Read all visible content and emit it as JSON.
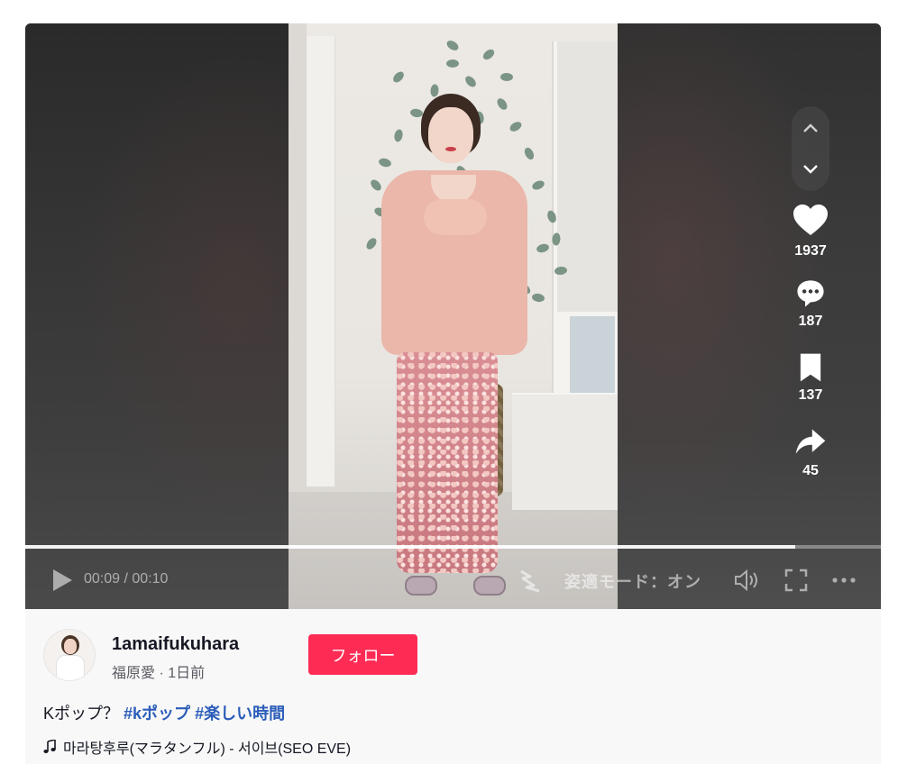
{
  "player": {
    "time_display": "00:09 / 00:10",
    "progress_fraction": 0.9,
    "mode_text": "姿適モード：オン"
  },
  "actions": {
    "likes": "1937",
    "comments": "187",
    "saves": "137",
    "shares": "45"
  },
  "author": {
    "username": "1amaifukuhara",
    "display_name_and_time": "福原愛 · 1日前",
    "follow_label": "フォロー"
  },
  "post": {
    "caption_text": "Kポップ？",
    "hashtags": [
      "#kポップ",
      "#楽しい時間"
    ],
    "music": "마라탕후루(マラタンフル) - 서이브(SEO EVE)"
  },
  "colors": {
    "follow_button": "#fe2c55",
    "hashtag": "#2b5db9",
    "panel_bg": "#f8f8f8"
  },
  "icons": [
    "chevron-up-icon",
    "chevron-down-icon",
    "heart-icon",
    "comment-icon",
    "bookmark-icon",
    "share-icon",
    "play-icon",
    "quality-icon",
    "volume-icon",
    "fullscreen-icon",
    "more-icon",
    "music-note-icon"
  ]
}
